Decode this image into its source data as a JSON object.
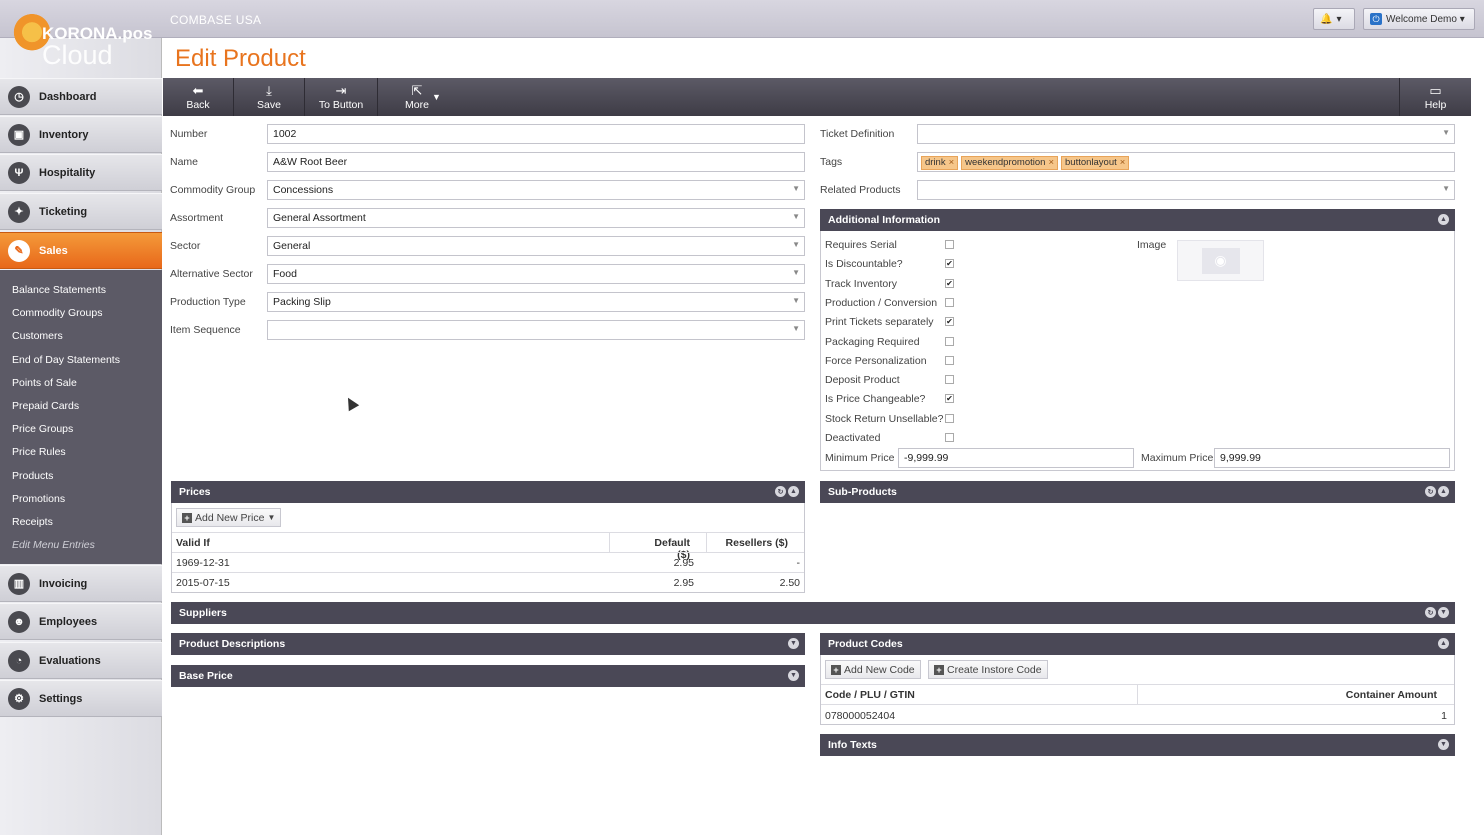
{
  "app": {
    "brand_line1": "KORONA.pos",
    "brand_line2": "Cloud",
    "company": "COMBASE USA",
    "welcome": "Welcome Demo ▾"
  },
  "nav": [
    {
      "label": "Dashboard",
      "icon": "dashboard-icon",
      "glyph": "◷"
    },
    {
      "label": "Inventory",
      "icon": "box-icon",
      "glyph": "▣"
    },
    {
      "label": "Hospitality",
      "icon": "cutlery-icon",
      "glyph": "Ψ"
    },
    {
      "label": "Ticketing",
      "icon": "ticket-icon",
      "glyph": "✦"
    },
    {
      "label": "Sales",
      "icon": "sales-icon",
      "glyph": "✎"
    },
    {
      "label": "Invoicing",
      "icon": "binders-icon",
      "glyph": "▥"
    },
    {
      "label": "Employees",
      "icon": "people-icon",
      "glyph": "☻"
    },
    {
      "label": "Evaluations",
      "icon": "pie-chart-icon",
      "glyph": "◔"
    },
    {
      "label": "Settings",
      "icon": "gears-icon",
      "glyph": "⚙"
    }
  ],
  "subnav": [
    "Balance Statements",
    "Commodity Groups",
    "Customers",
    "End of Day Statements",
    "Points of Sale",
    "Prepaid Cards",
    "Price Groups",
    "Price Rules",
    "Products",
    "Promotions",
    "Receipts",
    "Edit Menu Entries"
  ],
  "page": {
    "title": "Edit Product"
  },
  "toolbar": {
    "back": "Back",
    "save": "Save",
    "to_button": "To Button",
    "more": "More",
    "help": "Help"
  },
  "form": {
    "number_label": "Number",
    "number": "1002",
    "name_label": "Name",
    "name": "A&W Root Beer",
    "commodity_group_label": "Commodity Group",
    "commodity_group": "Concessions",
    "assortment_label": "Assortment",
    "assortment": "General Assortment",
    "sector_label": "Sector",
    "sector": "General",
    "alt_sector_label": "Alternative Sector",
    "alt_sector": "Food",
    "production_type_label": "Production Type",
    "production_type": "Packing Slip",
    "item_sequence_label": "Item Sequence",
    "item_sequence": "",
    "ticket_definition_label": "Ticket Definition",
    "ticket_definition": "",
    "tags_label": "Tags",
    "tags": [
      "drink",
      "weekendpromotion",
      "buttonlayout"
    ],
    "related_products_label": "Related Products",
    "related_products": ""
  },
  "additional": {
    "title": "Additional Information",
    "image_label": "Image",
    "checks": [
      {
        "label": "Requires Serial",
        "checked": false
      },
      {
        "label": "Is Discountable?",
        "checked": true
      },
      {
        "label": "Track Inventory",
        "checked": true
      },
      {
        "label": "Production / Conversion",
        "checked": false
      },
      {
        "label": "Print Tickets separately",
        "checked": true
      },
      {
        "label": "Packaging Required",
        "checked": false
      },
      {
        "label": "Force Personalization",
        "checked": false
      },
      {
        "label": "Deposit Product",
        "checked": false
      },
      {
        "label": "Is Price Changeable?",
        "checked": true
      },
      {
        "label": "Stock Return Unsellable?",
        "checked": false
      },
      {
        "label": "Deactivated",
        "checked": false
      }
    ],
    "min_price_label": "Minimum Price",
    "min_price": "-9,999.99",
    "max_price_label": "Maximum Price",
    "max_price": "9,999.99"
  },
  "prices": {
    "title": "Prices",
    "add_label": "Add New Price",
    "headers": [
      "Valid If",
      "Default ($)",
      "Resellers ($)"
    ],
    "rows": [
      [
        "1969-12-31",
        "2.95",
        "-"
      ],
      [
        "2015-07-15",
        "2.95",
        "2.50"
      ]
    ]
  },
  "subproducts": {
    "title": "Sub-Products"
  },
  "suppliers": {
    "title": "Suppliers"
  },
  "descriptions": {
    "title": "Product Descriptions"
  },
  "baseprice": {
    "title": "Base Price"
  },
  "codes": {
    "title": "Product Codes",
    "add_label": "Add New Code",
    "instore_label": "Create Instore Code",
    "headers": [
      "Code / PLU / GTIN",
      "Container Amount"
    ],
    "rows": [
      [
        "078000052404",
        "1"
      ]
    ]
  },
  "infotexts": {
    "title": "Info Texts"
  }
}
